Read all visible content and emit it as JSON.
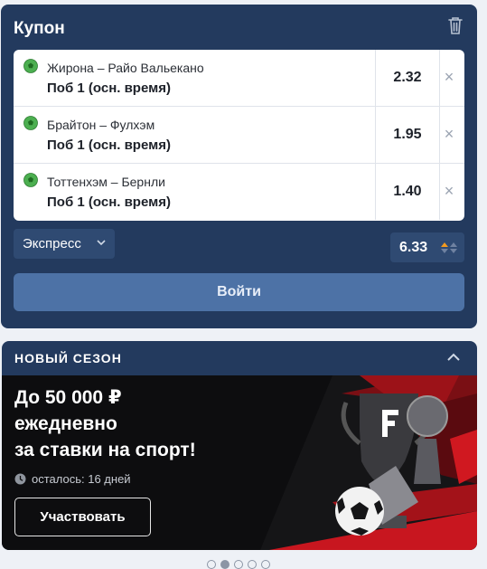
{
  "coupon": {
    "title": "Купон",
    "bets": [
      {
        "match": "Жирона – Райо Вальекано",
        "market": "Поб 1 (осн. время)",
        "odds": "2.32"
      },
      {
        "match": "Брайтон – Фулхэм",
        "market": "Поб 1 (осн. время)",
        "odds": "1.95"
      },
      {
        "match": "Тоттенхэм – Бернли",
        "market": "Поб 1 (осн. время)",
        "odds": "1.40"
      }
    ],
    "bet_type": "Экспресс",
    "total_odds": "6.33",
    "login_label": "Войти"
  },
  "promo": {
    "header": "НОВЫЙ СЕЗОН",
    "title_line1": "До 50 000 ₽",
    "title_line2": "ежедневно",
    "title_line3": "за ставки на спорт!",
    "time_left": "осталось: 16 дней",
    "button_label": "Участвовать"
  },
  "carousel": {
    "count": 5,
    "active_index": 1
  },
  "colors": {
    "panel": "#233a5e",
    "login_button": "#4d72a6",
    "accent_up": "#f29a1f",
    "ball_icon": "#4caf50"
  },
  "icons": [
    "trash-icon",
    "football-icon",
    "close-icon",
    "chevron-down-icon",
    "odds-arrows-icon",
    "chevron-up-icon",
    "clock-icon"
  ]
}
